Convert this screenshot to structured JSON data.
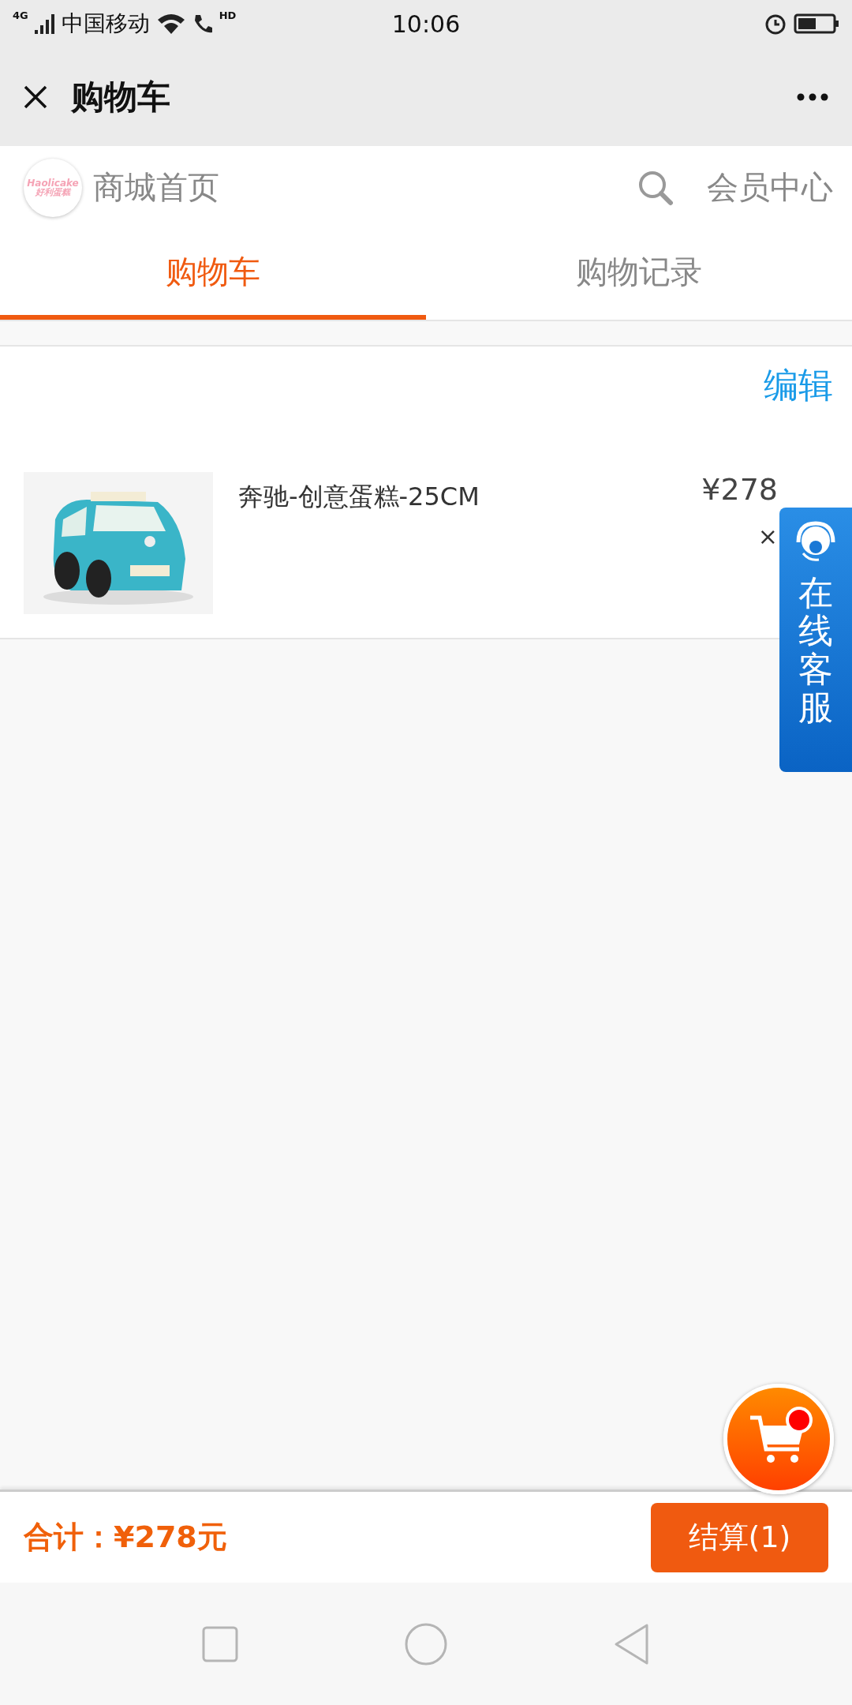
{
  "status_bar": {
    "network": "4G",
    "carrier": "中国移动",
    "call": "HD",
    "time": "10:06"
  },
  "title_bar": {
    "title": "购物车"
  },
  "header": {
    "logo": {
      "latin": "Haolicake",
      "chinese": "好利蛋糕"
    },
    "home_link": "商城首页",
    "member_link": "会员中心"
  },
  "tabs": [
    {
      "label": "购物车",
      "selected": true
    },
    {
      "label": "购物记录",
      "selected": false
    }
  ],
  "cart": {
    "edit": "编辑",
    "items": [
      {
        "kind": "picture",
        "name": "奔驰-创意蛋糕-25CM",
        "price": "¥278",
        "remove": "×"
      }
    ]
  },
  "service_tab": {
    "label": "在线客服"
  },
  "floating_cart": {
    "has_badge": true
  },
  "footer": {
    "total": "合计：¥278元",
    "checkout": "结算(1)"
  }
}
